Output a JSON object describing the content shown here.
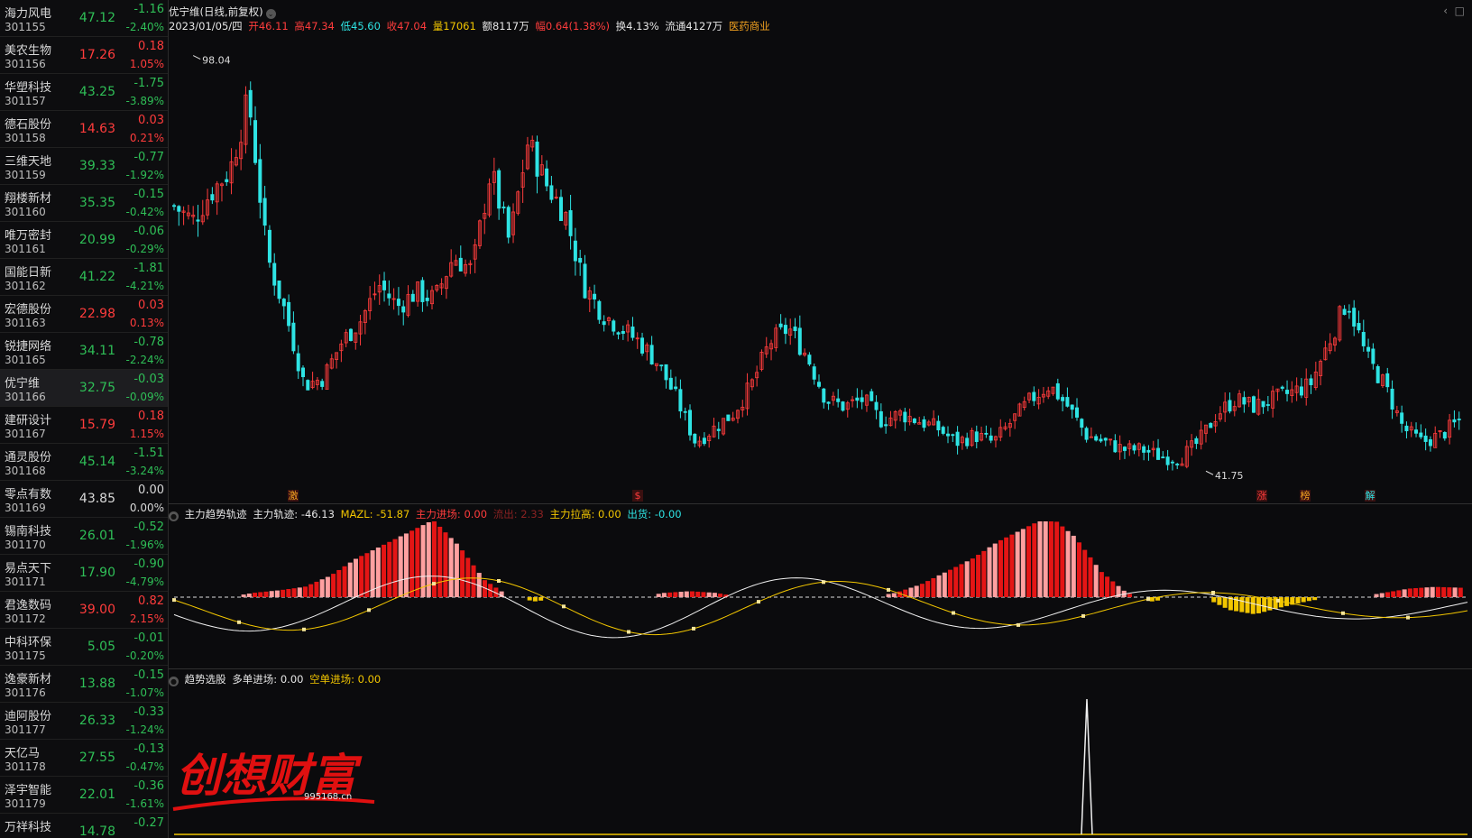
{
  "stock_list": [
    {
      "name": "海力风电",
      "code": "301155",
      "price": "47.12",
      "change": "-1.16",
      "pct": "-2.40%",
      "dir": "down"
    },
    {
      "name": "美农生物",
      "code": "301156",
      "price": "17.26",
      "change": "0.18",
      "pct": "1.05%",
      "dir": "up"
    },
    {
      "name": "华塑科技",
      "code": "301157",
      "price": "43.25",
      "change": "-1.75",
      "pct": "-3.89%",
      "dir": "down"
    },
    {
      "name": "德石股份",
      "code": "301158",
      "price": "14.63",
      "change": "0.03",
      "pct": "0.21%",
      "dir": "up"
    },
    {
      "name": "三维天地",
      "code": "301159",
      "price": "39.33",
      "change": "-0.77",
      "pct": "-1.92%",
      "dir": "down"
    },
    {
      "name": "翔楼新材",
      "code": "301160",
      "price": "35.35",
      "change": "-0.15",
      "pct": "-0.42%",
      "dir": "down"
    },
    {
      "name": "唯万密封",
      "code": "301161",
      "price": "20.99",
      "change": "-0.06",
      "pct": "-0.29%",
      "dir": "down"
    },
    {
      "name": "国能日新",
      "code": "301162",
      "price": "41.22",
      "change": "-1.81",
      "pct": "-4.21%",
      "dir": "down"
    },
    {
      "name": "宏德股份",
      "code": "301163",
      "price": "22.98",
      "change": "0.03",
      "pct": "0.13%",
      "dir": "up"
    },
    {
      "name": "锐捷网络",
      "code": "301165",
      "price": "34.11",
      "change": "-0.78",
      "pct": "-2.24%",
      "dir": "down"
    },
    {
      "name": "优宁维",
      "code": "301166",
      "price": "32.75",
      "change": "-0.03",
      "pct": "-0.09%",
      "dir": "down",
      "selected": true
    },
    {
      "name": "建研设计",
      "code": "301167",
      "price": "15.79",
      "change": "0.18",
      "pct": "1.15%",
      "dir": "up"
    },
    {
      "name": "通灵股份",
      "code": "301168",
      "price": "45.14",
      "change": "-1.51",
      "pct": "-3.24%",
      "dir": "down"
    },
    {
      "name": "零点有数",
      "code": "301169",
      "price": "43.85",
      "change": "0.00",
      "pct": "0.00%",
      "dir": "flat"
    },
    {
      "name": "锡南科技",
      "code": "301170",
      "price": "26.01",
      "change": "-0.52",
      "pct": "-1.96%",
      "dir": "down"
    },
    {
      "name": "易点天下",
      "code": "301171",
      "price": "17.90",
      "change": "-0.90",
      "pct": "-4.79%",
      "dir": "down"
    },
    {
      "name": "君逸数码",
      "code": "301172",
      "price": "39.00",
      "change": "0.82",
      "pct": "2.15%",
      "dir": "up"
    },
    {
      "name": "中科环保",
      "code": "301175",
      "price": "5.05",
      "change": "-0.01",
      "pct": "-0.20%",
      "dir": "down"
    },
    {
      "name": "逸豪新材",
      "code": "301176",
      "price": "13.88",
      "change": "-0.15",
      "pct": "-1.07%",
      "dir": "down"
    },
    {
      "name": "迪阿股份",
      "code": "301177",
      "price": "26.33",
      "change": "-0.33",
      "pct": "-1.24%",
      "dir": "down"
    },
    {
      "name": "天亿马",
      "code": "301178",
      "price": "27.55",
      "change": "-0.13",
      "pct": "-0.47%",
      "dir": "down"
    },
    {
      "name": "泽宇智能",
      "code": "301179",
      "price": "22.01",
      "change": "-0.36",
      "pct": "-1.61%",
      "dir": "down"
    },
    {
      "name": "万祥科技",
      "code": "",
      "price": "14.78",
      "change": "-0.27",
      "pct": "",
      "dir": "down"
    }
  ],
  "kline_header": {
    "title": "优宁维(日线,前复权)",
    "date": "2023/01/05/四",
    "open": "开46.11",
    "high": "高47.34",
    "low": "低45.60",
    "close": "收47.04",
    "volume": "量17061",
    "amount": "额8117万",
    "amplitude": "幅0.64(1.38%)",
    "turnover": "换4.13%",
    "float_cap": "流通4127万",
    "sector": "医药商业"
  },
  "kline_marks": {
    "high_label": "98.04",
    "low_label": "41.75"
  },
  "signal_marks": [
    "激",
    "$",
    "涨",
    "榜",
    "解"
  ],
  "indicator1": {
    "name": "主力趋势轨迹",
    "track": "主力轨迹: -46.13",
    "mazl": "MAZL: -51.87",
    "enter": "主力进场: 0.00",
    "outflow": "流出: 2.33",
    "lift": "主力拉高: 0.00",
    "sell": "出货: -0.00"
  },
  "indicator2": {
    "name": "趋势选股",
    "long": "多单进场: 0.00",
    "short": "空单进场: 0.00"
  },
  "watermark": {
    "text": "创想财富",
    "url": "995168.cn"
  },
  "colors": {
    "up": "#ff3c3c",
    "down": "#2fbf57",
    "cyan": "#2ee3e3",
    "yellow": "#f2c600",
    "pink": "#ffa0a0"
  },
  "chart_data": [
    {
      "type": "candlestick",
      "title": "优宁维(日线,前复权)",
      "annotations": [
        "98.04",
        "41.75"
      ],
      "close_approx": [
        77,
        75,
        79,
        82,
        92,
        70,
        62,
        52,
        53,
        58,
        61,
        66,
        63,
        65,
        64,
        70,
        68,
        82,
        72,
        86,
        80,
        76,
        66,
        62,
        60,
        58,
        55,
        50,
        44,
        46,
        48,
        52,
        58,
        60,
        56,
        50,
        49,
        50,
        47,
        48,
        47,
        46,
        44,
        45,
        44,
        47,
        50,
        52,
        49,
        45,
        44,
        43,
        43,
        42,
        41.75,
        44,
        48,
        50,
        49,
        50,
        51,
        52,
        58,
        64,
        56,
        52,
        46,
        44,
        45,
        47
      ]
    },
    {
      "type": "bar",
      "title": "主力趋势轨迹",
      "values_approx": [
        0,
        0,
        0,
        0.5,
        0.8,
        1.2,
        2.5,
        4.5,
        6,
        7.5,
        9,
        6,
        2,
        0,
        -0.5,
        0,
        0,
        0,
        0,
        0.5,
        0.7,
        0.5,
        0,
        0,
        0,
        0,
        0,
        0,
        0.5,
        1.5,
        3,
        4.5,
        6.5,
        8,
        9.5,
        7,
        3,
        0.5,
        -0.5,
        0,
        0,
        -1.5,
        -2,
        -1.2,
        -0.5,
        0,
        0,
        0.5,
        1,
        1.2,
        1.1
      ]
    },
    {
      "type": "line",
      "title": "趋势选股",
      "values_approx": [
        0,
        0,
        0,
        0,
        0,
        0,
        0,
        0,
        1,
        0,
        0,
        0
      ]
    }
  ]
}
